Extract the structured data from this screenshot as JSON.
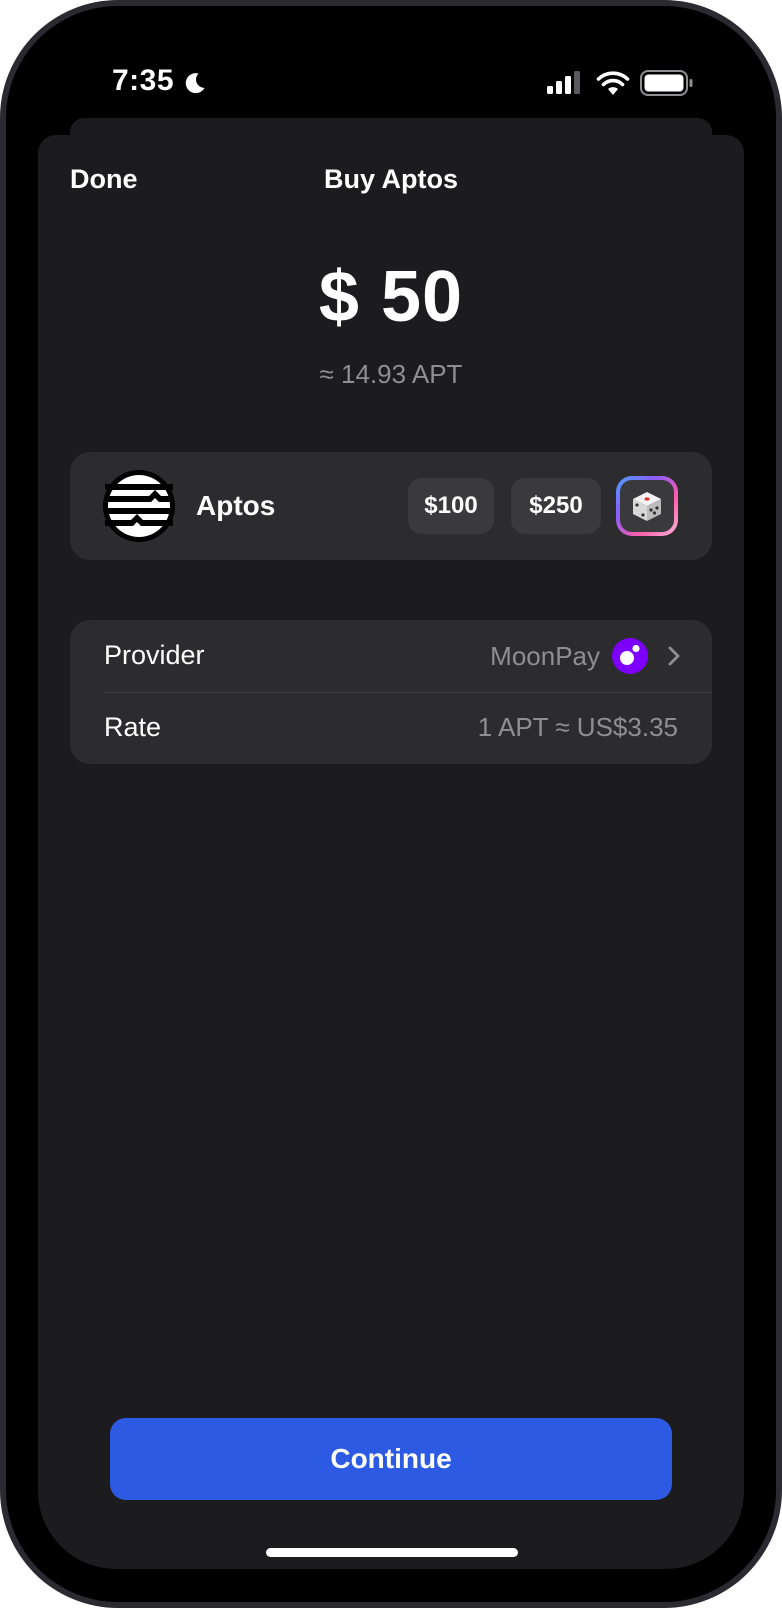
{
  "status_bar": {
    "time": "7:35",
    "icons": [
      "moon-icon",
      "signal-icon",
      "wifi-icon",
      "battery-icon"
    ]
  },
  "nav": {
    "done_label": "Done",
    "title": "Buy Aptos"
  },
  "amount": {
    "value": "$ 50",
    "converted": "≈ 14.93 APT"
  },
  "asset": {
    "name": "Aptos",
    "logo_icon": "aptos-logo-icon",
    "presets": [
      "$100",
      "$250"
    ],
    "random_icon": "dice-icon"
  },
  "details": {
    "provider_label": "Provider",
    "provider_value": "MoonPay",
    "provider_icon": "moonpay-icon",
    "rate_label": "Rate",
    "rate_value": "1 APT ≈ US$3.35"
  },
  "continue_label": "Continue",
  "colors": {
    "background": "#1c1c1e",
    "card": "#2c2c2e",
    "accent": "#2d5ae3",
    "secondary_text": "#8e8e93",
    "moonpay": "#7d00ff"
  }
}
